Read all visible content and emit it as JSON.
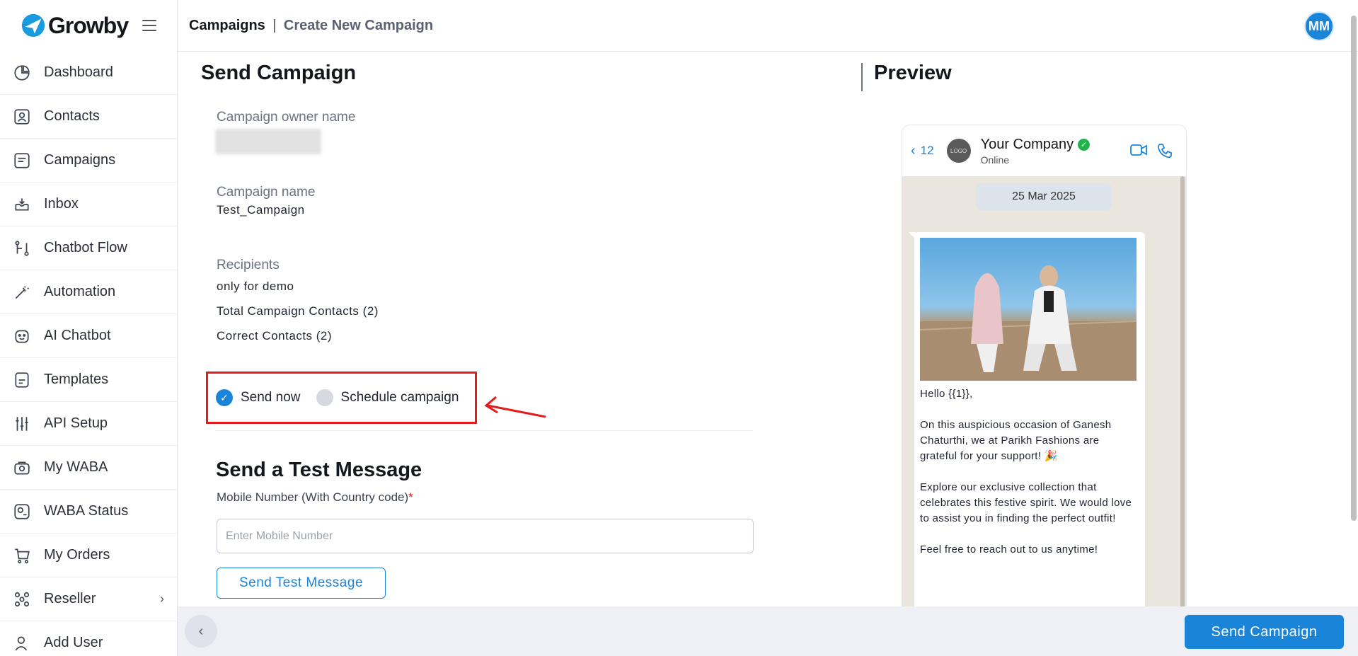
{
  "brand": {
    "name": "Growby"
  },
  "sidebar": {
    "items": [
      {
        "label": "Dashboard",
        "icon": "pie-chart-icon"
      },
      {
        "label": "Contacts",
        "icon": "contact-card-icon"
      },
      {
        "label": "Campaigns",
        "icon": "campaign-icon"
      },
      {
        "label": "Inbox",
        "icon": "inbox-icon"
      },
      {
        "label": "Chatbot Flow",
        "icon": "flow-icon"
      },
      {
        "label": "Automation",
        "icon": "magic-wand-icon"
      },
      {
        "label": "AI Chatbot",
        "icon": "bot-face-icon"
      },
      {
        "label": "Templates",
        "icon": "template-icon"
      },
      {
        "label": "API Setup",
        "icon": "sliders-icon"
      },
      {
        "label": "My WABA",
        "icon": "waba-icon"
      },
      {
        "label": "WABA Status",
        "icon": "status-icon"
      },
      {
        "label": "My Orders",
        "icon": "cart-icon"
      },
      {
        "label": "Reseller",
        "icon": "reseller-icon"
      },
      {
        "label": "Add User",
        "icon": "add-user-icon"
      }
    ]
  },
  "header": {
    "section": "Campaigns",
    "separator": "|",
    "page": "Create New Campaign",
    "avatar": "MM"
  },
  "form": {
    "title": "Send Campaign",
    "owner_label": "Campaign owner name",
    "name_label": "Campaign name",
    "name_value": "Test_Campaign",
    "recipients_label": "Recipients",
    "recipients_group": "only for demo",
    "total_contacts": "Total Campaign Contacts (2)",
    "correct_contacts": "Correct Contacts (2)",
    "send_now": "Send now",
    "schedule": "Schedule campaign"
  },
  "test": {
    "title": "Send a Test Message",
    "mobile_label": "Mobile Number (With Country code)",
    "required_mark": "*",
    "placeholder": "Enter Mobile Number",
    "button": "Send Test Message"
  },
  "preview": {
    "title": "Preview",
    "back_count": "12",
    "logo_text": "LOGO",
    "company": "Your Company",
    "status": "Online",
    "date": "25 Mar 2025",
    "message": "Hello {{1}},\n\nOn this auspicious occasion of Ganesh Chaturthi, we at Parikh Fashions are grateful for your support! 🎉\n\nExplore our exclusive collection that celebrates this festive spirit. We would love to assist you in finding the perfect outfit!\n\nFeel free to reach out to us anytime!"
  },
  "footer": {
    "send_button": "Send Campaign"
  },
  "colors": {
    "accent": "#1a84d8",
    "highlight": "#e21b1b",
    "verified": "#22b24c"
  }
}
